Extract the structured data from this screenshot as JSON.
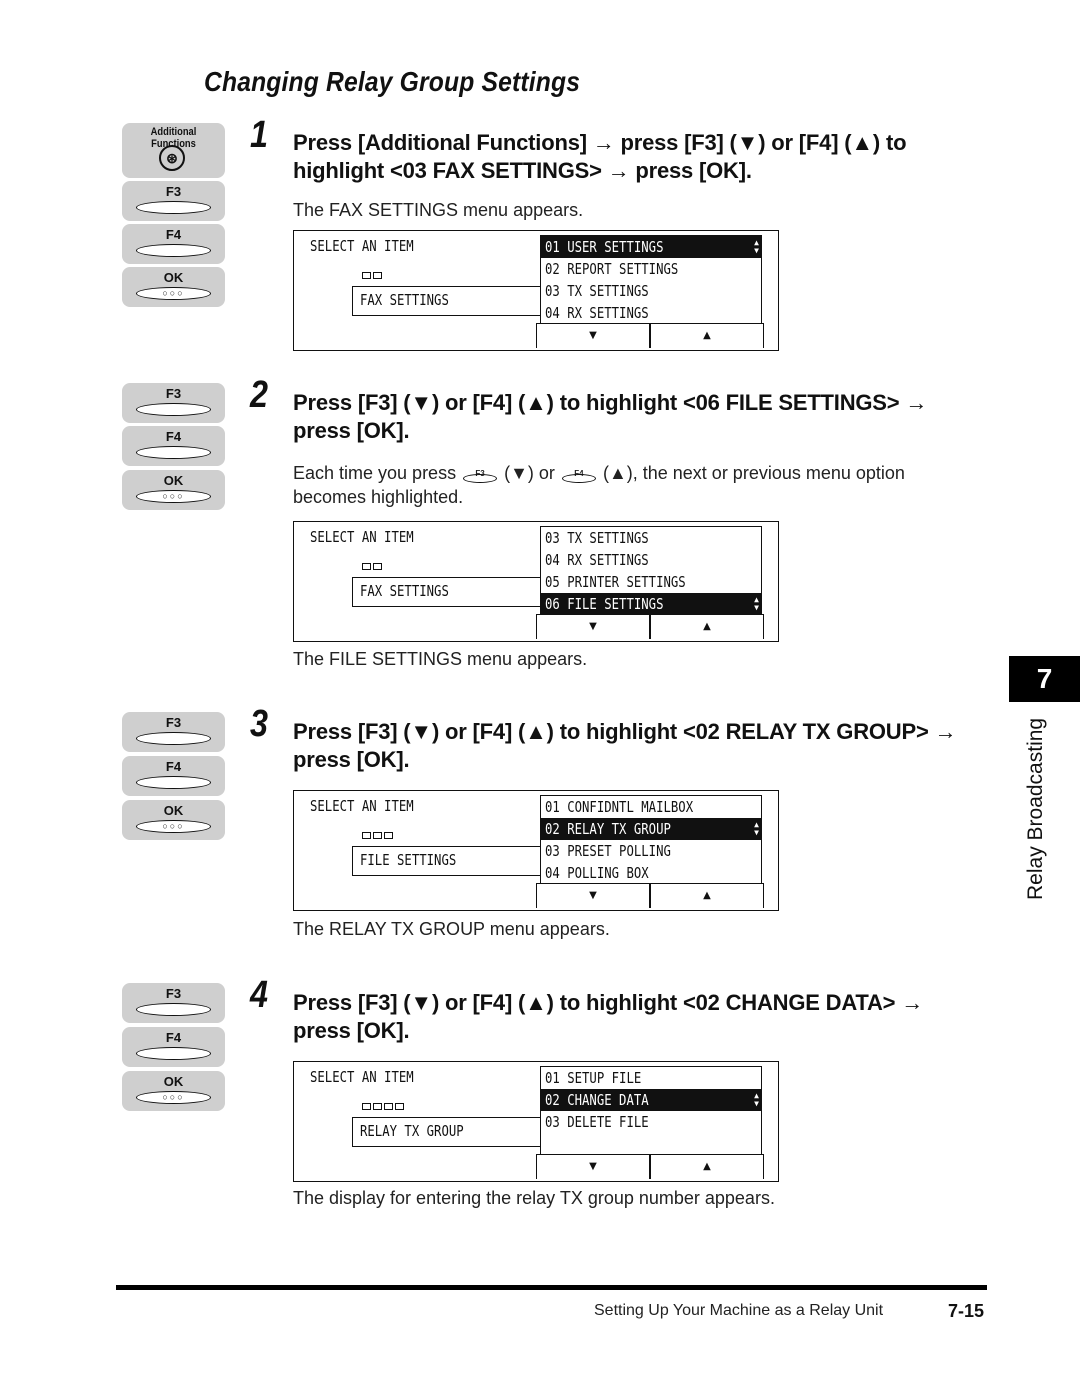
{
  "page_title": "Changing Relay Group Settings",
  "keys": {
    "additional_functions": "Additional Functions",
    "f3": "F3",
    "f4": "F4",
    "ok": "OK",
    "ok_dots": "○○○",
    "af_glyph": "⊛"
  },
  "steps": [
    {
      "number": "1",
      "instruction": "Press [Additional Functions] → press [F3] (▼) or [F4] (▲) to highlight <03 FAX SETTINGS> → press [OK].",
      "note": "The FAX SETTINGS menu appears.",
      "lcd": {
        "title": "SELECT AN ITEM",
        "breadcrumb_boxes": 2,
        "field": "FAX SETTINGS",
        "items": [
          "01  USER SETTINGS",
          "02  REPORT SETTINGS",
          "03  TX SETTINGS",
          "04  RX SETTINGS"
        ],
        "selected_index": 0,
        "down_label": "▼",
        "up_label": "▲"
      }
    },
    {
      "number": "2",
      "instruction": "Press [F3] (▼) or [F4] (▲) to highlight <06 FILE SETTINGS> → press [OK].",
      "hint_part1": "Each time you press",
      "hint_part2": "(▼) or",
      "hint_part3": "(▲), the next or previous menu option",
      "hint_part4": "becomes highlighted.",
      "note_after": "The FILE SETTINGS menu appears.",
      "lcd": {
        "title": "SELECT AN ITEM",
        "breadcrumb_boxes": 2,
        "field": "FAX SETTINGS",
        "items": [
          "03  TX SETTINGS",
          "04  RX SETTINGS",
          "05  PRINTER SETTINGS",
          "06  FILE SETTINGS"
        ],
        "selected_index": 3,
        "down_label": "▼",
        "up_label": "▲"
      }
    },
    {
      "number": "3",
      "instruction": "Press [F3] (▼) or [F4] (▲) to highlight <02 RELAY TX GROUP> → press [OK].",
      "note_after": "The RELAY TX GROUP menu appears.",
      "lcd": {
        "title": "SELECT AN ITEM",
        "breadcrumb_boxes": 3,
        "field": "FILE SETTINGS",
        "items": [
          "01  CONFIDNTL MAILBOX",
          "02  RELAY TX GROUP",
          "03  PRESET POLLING",
          "04  POLLING BOX"
        ],
        "selected_index": 1,
        "down_label": "▼",
        "up_label": "▲"
      }
    },
    {
      "number": "4",
      "instruction": "Press [F3] (▼) or [F4] (▲) to highlight <02 CHANGE DATA> → press [OK].",
      "note_after": "The display for entering the relay TX group number appears.",
      "lcd": {
        "title": "SELECT AN ITEM",
        "breadcrumb_boxes": 4,
        "field": "RELAY TX GROUP",
        "items": [
          "01  SETUP FILE",
          "02  CHANGE DATA",
          "03  DELETE FILE"
        ],
        "selected_index": 1,
        "down_label": "▼",
        "up_label": "▲"
      }
    }
  ],
  "chapter_tab": "7",
  "side_label": "Relay Broadcasting",
  "footer": {
    "section": "Setting Up Your Machine as a Relay Unit",
    "page": "7-15"
  }
}
